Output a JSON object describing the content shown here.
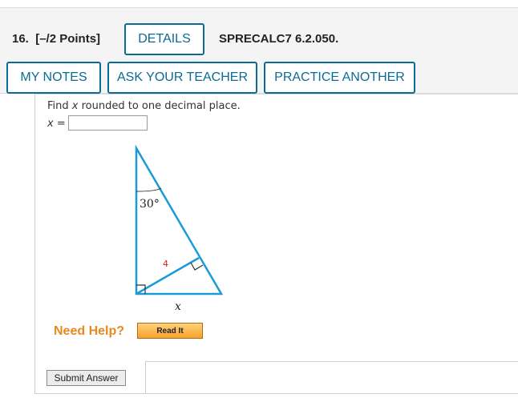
{
  "question": {
    "number_label": "16.",
    "points_label": "[–/2 Points]",
    "code": "SPRECALC7 6.2.050."
  },
  "buttons": {
    "details": "DETAILS",
    "my_notes": "MY NOTES",
    "ask_teacher": "ASK YOUR TEACHER",
    "practice_another": "PRACTICE ANOTHER"
  },
  "problem": {
    "prompt_before": "Find ",
    "prompt_var": "x",
    "prompt_after": " rounded to one decimal place.",
    "answer_label": "x =",
    "answer_value": ""
  },
  "figure": {
    "angle_label": "30°",
    "altitude_label": "4",
    "base_label": "x",
    "line_color": "#1a9bd7",
    "altitude_label_color": "#cc2222"
  },
  "help": {
    "label": "Need Help?",
    "read_it": "Read It"
  },
  "submit": {
    "label": "Submit Answer"
  }
}
